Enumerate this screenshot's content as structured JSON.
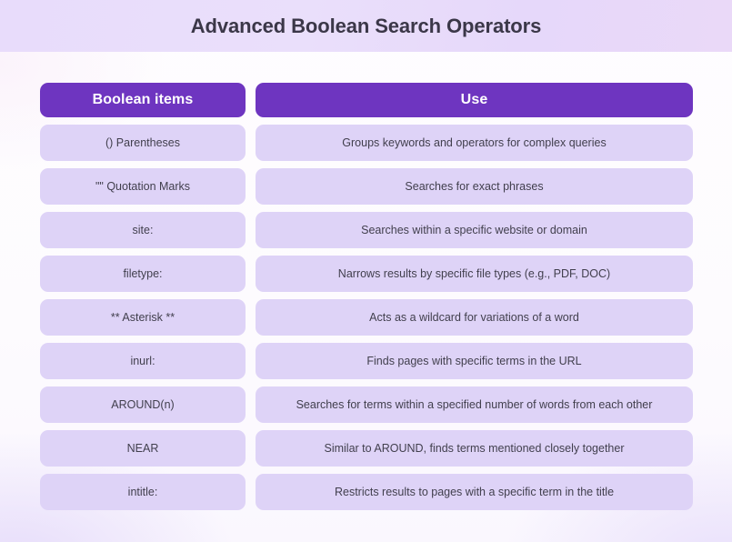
{
  "banner": {
    "title": "Advanced Boolean Search Operators"
  },
  "table": {
    "headers": {
      "left": "Boolean items",
      "right": "Use"
    },
    "rows": [
      {
        "item": "() Parentheses",
        "use": "Groups keywords and operators for complex queries"
      },
      {
        "item": "\"\" Quotation Marks",
        "use": "Searches for exact phrases"
      },
      {
        "item": "site:",
        "use": "Searches within a specific website or domain"
      },
      {
        "item": "filetype:",
        "use": "Narrows results by specific file types (e.g., PDF, DOC)"
      },
      {
        "item": "** Asterisk **",
        "use": "Acts as a wildcard for variations of a word"
      },
      {
        "item": "inurl:",
        "use": "Finds pages with specific terms in the URL"
      },
      {
        "item": "AROUND(n)",
        "use": "Searches for terms within a specified number of words from each other"
      },
      {
        "item": "NEAR",
        "use": "Similar to AROUND, finds terms mentioned closely together"
      },
      {
        "item": "intitle:",
        "use": "Restricts results to pages with a specific term in the title"
      }
    ]
  },
  "colors": {
    "banner_background": "#e8dcfb",
    "header_pill": "#6e35c0",
    "header_pill_text": "#ffffff",
    "row_pill": "#ded3f7",
    "row_pill_text": "#413f4d",
    "title_text": "#3b3748",
    "page_background": "#fdfcfe"
  }
}
